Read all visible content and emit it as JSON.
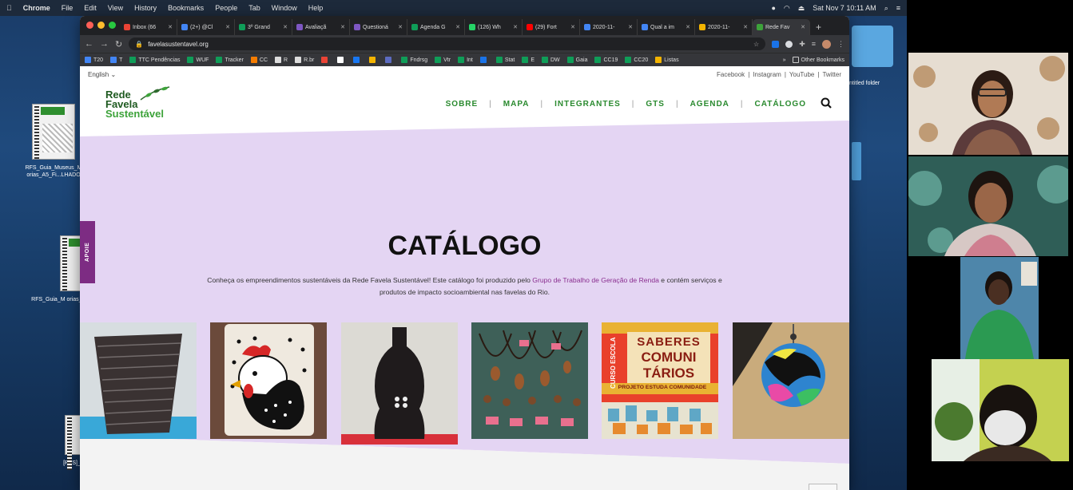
{
  "menubar": {
    "apple": "",
    "app": "Chrome",
    "items": [
      "File",
      "Edit",
      "View",
      "History",
      "Bookmarks",
      "People",
      "Tab",
      "Window",
      "Help"
    ],
    "clock": "Sat Nov 7  10:11 AM"
  },
  "desktop": {
    "icons": [
      {
        "label": "RFS_Guia_Museus_M orias_A5_Fi...LHADO"
      },
      {
        "label": "RFS_Guia_M orias_A5_Fi"
      },
      {
        "label": "[RFS]_"
      }
    ],
    "folder_label": "ntitled folder"
  },
  "browser": {
    "tabs": [
      {
        "label": "Inbox (66",
        "color": "#ea4335"
      },
      {
        "label": "(2+) @Cl",
        "color": "#4285f4"
      },
      {
        "label": "3º Grand",
        "color": "#0f9d58"
      },
      {
        "label": "Avaliaçã",
        "color": "#7e57c2"
      },
      {
        "label": "Questioná",
        "color": "#7e57c2"
      },
      {
        "label": "Agenda G",
        "color": "#0f9d58"
      },
      {
        "label": "(126) Wh",
        "color": "#25d366"
      },
      {
        "label": "(29) Fort",
        "color": "#ff0000"
      },
      {
        "label": "2020-11-",
        "color": "#4285f4"
      },
      {
        "label": "Qual a im",
        "color": "#4285f4"
      },
      {
        "label": "2020-11-",
        "color": "#f4b400"
      },
      {
        "label": "Rede Fav",
        "color": "#3da33a",
        "active": true
      }
    ],
    "url": "favelasustentavel.org",
    "bookmarks": [
      "T20",
      "T",
      "TTC Pendências",
      "WUF",
      "Tracker",
      "CC",
      "R",
      "R.br",
      "",
      "",
      "",
      "",
      "",
      "Fndrsg",
      "Vtr",
      "Int",
      "",
      "Stat",
      "E",
      "DW",
      "Gaia",
      "CC19",
      "CC20",
      "Listas"
    ],
    "bookmarks_more": "»",
    "other_bookmarks": "Other Bookmarks"
  },
  "site": {
    "language": "English",
    "social": [
      "Facebook",
      "|",
      "Instagram",
      "|",
      "YouTube",
      "|",
      "Twitter"
    ],
    "logo": {
      "line1": "Rede",
      "line2": "Favela",
      "line3": "Sustentável"
    },
    "nav": [
      "SOBRE",
      "MAPA",
      "INTEGRANTES",
      "GTS",
      "AGENDA",
      "CATÁLOGO"
    ],
    "apoie": "APOIE",
    "title": "CATÁLOGO",
    "intro_before": "Conheça os empreendimentos sustentáveis da Rede Favela Sustentável! Este catálogo foi produzido pelo ",
    "intro_link": "Grupo de Trabalho de Geração de Renda",
    "intro_after": " e contém serviços e produtos de impacto socioambiental nas favelas do Rio.",
    "card_text": {
      "top": "SABERES",
      "mid1": "COMUNI",
      "mid2": "TÁRIOS",
      "side": "CURSO ESCOLA",
      "bottom": "PROJETO ESTUDA COMUNIDADE"
    },
    "up_arrow": "︿"
  },
  "colors": {
    "accent_green": "#2a8a2f",
    "hero_lilac": "#e4d5f3",
    "apoie_purple": "#7d2c83"
  }
}
